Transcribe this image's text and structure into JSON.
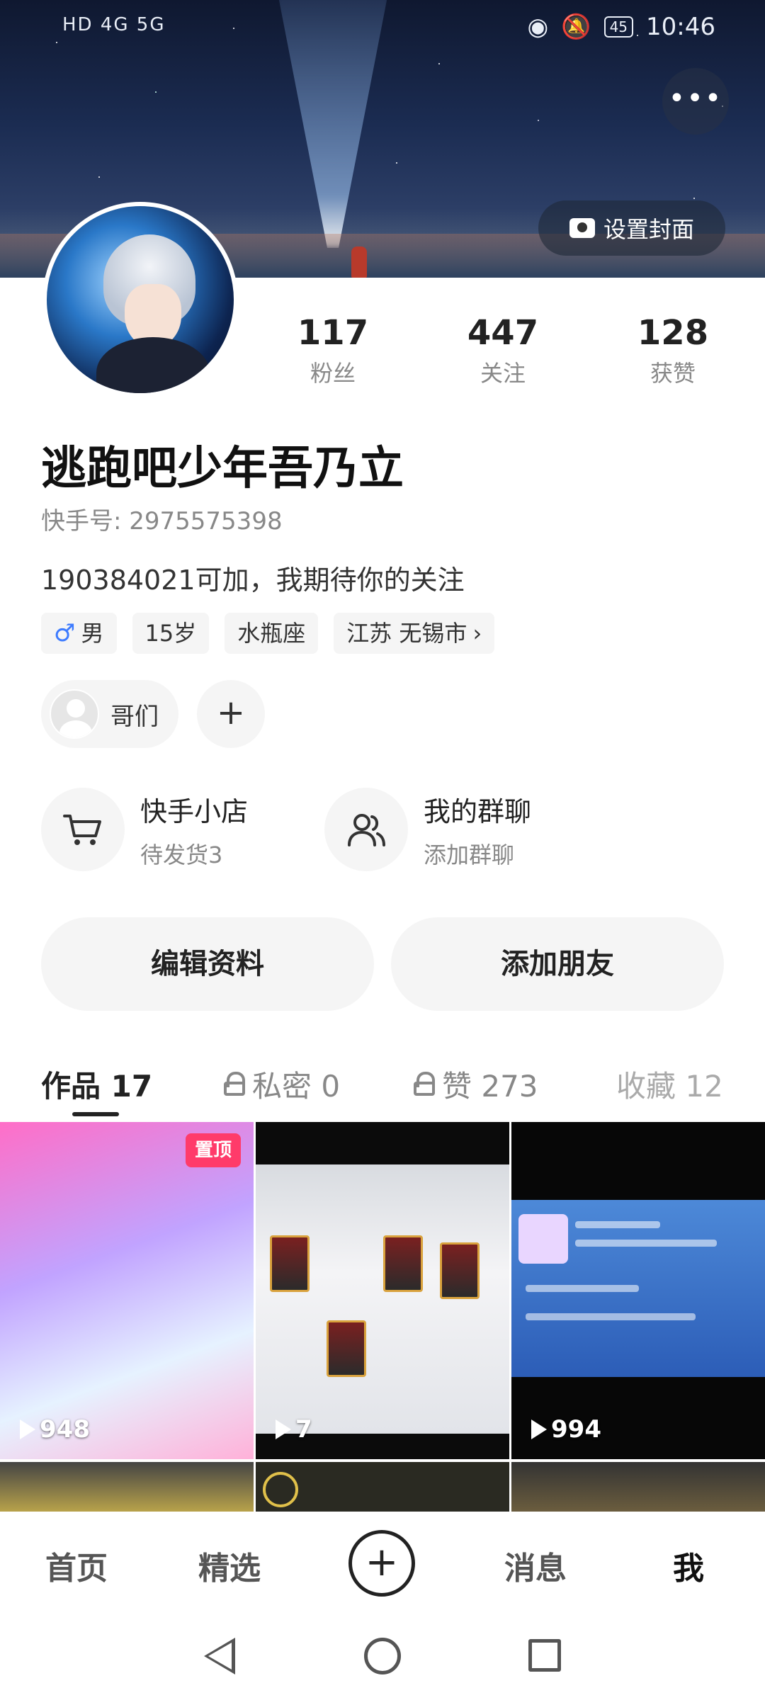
{
  "status_bar": {
    "left": "HD 4G 5G",
    "time": "10:46",
    "battery": "45"
  },
  "cover": {
    "set_cover_label": "设置封面"
  },
  "profile": {
    "name": "逃跑吧少年吾乃立",
    "kuaishou_id": "快手号: 2975575398",
    "bio": "190384021可加，我期待你的关注",
    "stats": [
      {
        "value": "117",
        "label": "粉丝"
      },
      {
        "value": "447",
        "label": "关注"
      },
      {
        "value": "128",
        "label": "获赞"
      }
    ],
    "tags": {
      "gender": "男",
      "age": "15岁",
      "zodiac": "水瓶座",
      "location": "江苏 无锡市"
    }
  },
  "friend": {
    "label": "哥们"
  },
  "entries": [
    {
      "title": "快手小店",
      "sub": "待发货3"
    },
    {
      "title": "我的群聊",
      "sub": "添加群聊"
    }
  ],
  "actions": {
    "edit_profile": "编辑资料",
    "add_friend": "添加朋友"
  },
  "tabs": [
    {
      "label": "作品 17"
    },
    {
      "label": "私密 0"
    },
    {
      "label": "赞 273"
    },
    {
      "label": "收藏 12"
    }
  ],
  "videos": [
    {
      "pin": "置顶",
      "plays": "948"
    },
    {
      "plays": "7"
    },
    {
      "plays": "994"
    }
  ],
  "bottom_nav": {
    "home": "首页",
    "featured": "精选",
    "messages": "消息",
    "me": "我"
  }
}
